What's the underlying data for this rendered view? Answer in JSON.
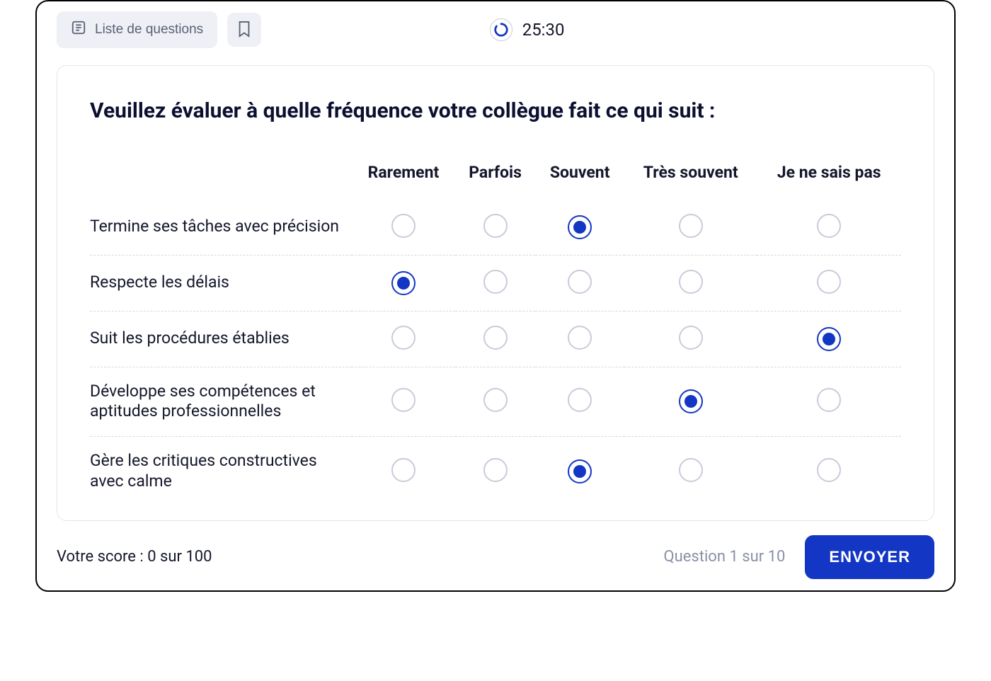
{
  "topbar": {
    "question_list_label": "Liste de questions",
    "timer": "25:30"
  },
  "question": {
    "title": "Veuillez évaluer à quelle fréquence votre collègue fait ce qui suit :"
  },
  "columns": [
    "Rarement",
    "Parfois",
    "Souvent",
    "Très souvent",
    "Je ne sais pas"
  ],
  "rows": [
    {
      "label": "Termine ses tâches avec précision",
      "selected": 2
    },
    {
      "label": "Respecte les délais",
      "selected": 0
    },
    {
      "label": "Suit les procédures établies",
      "selected": 4
    },
    {
      "label": "Développe ses compétences et aptitudes professionnelles",
      "selected": 3
    },
    {
      "label": "Gère les critiques constructives avec calme",
      "selected": 2
    }
  ],
  "footer": {
    "score": "Votre score : 0 sur 100",
    "progress": "Question 1 sur 10",
    "submit": "ENVOYER"
  }
}
